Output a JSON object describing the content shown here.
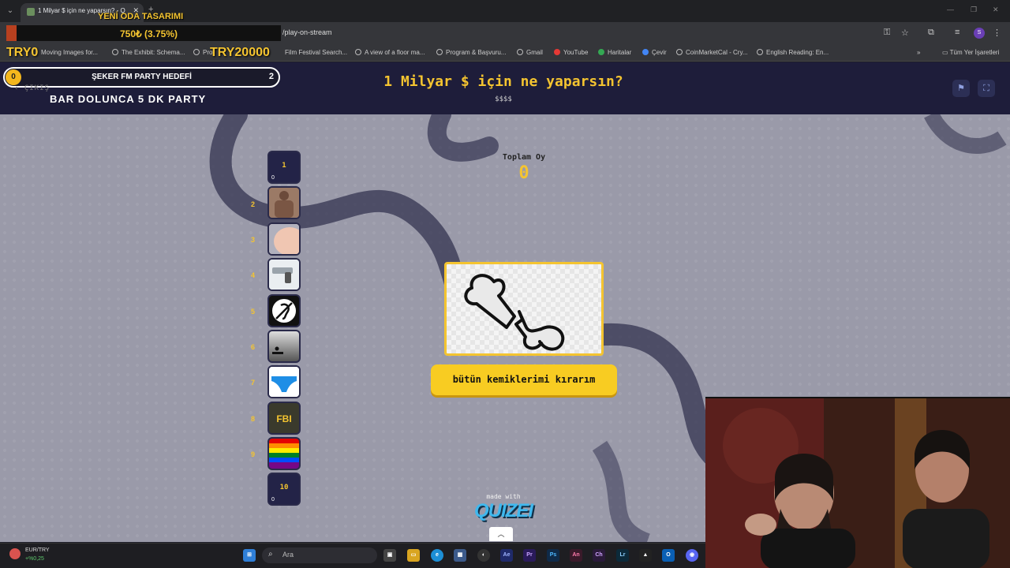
{
  "browser": {
    "tab_title": "1 Milyar $ için ne yaparsın? - Q",
    "url": "/play-on-stream",
    "bookmarks": [
      {
        "label": "Moving Images for..."
      },
      {
        "label": "The Exhibit: Schema..."
      },
      {
        "label": "Pro"
      },
      {
        "label": "Film Festival Search..."
      },
      {
        "label": "A view of a floor ma..."
      },
      {
        "label": "Program & Başvuru..."
      },
      {
        "label": "Gmail"
      },
      {
        "label": "YouTube"
      },
      {
        "label": "Haritalar"
      },
      {
        "label": "Çevir"
      },
      {
        "label": "CoinMarketCal - Cry..."
      },
      {
        "label": "English Reading: En..."
      }
    ],
    "all_bookmarks": "Tüm Yer İşaretleri",
    "profile_initial": "S"
  },
  "overlay": {
    "title": "YENİ ODA TASARIMI",
    "progress_text": "750₺ (3.75%)",
    "progress_fraction": 0.0375,
    "start_label": "TRY0",
    "end_label": "TRY20000"
  },
  "quiz": {
    "goal": {
      "start": "0",
      "label": "ŞEKER FM PARTY HEDEFİ",
      "end": "2"
    },
    "exit_label": "ÇIKIŞ",
    "party_label": "BAR DOLUNCA 5 DK PARTY",
    "title": "1 Milyar $ için ne yaparsın?",
    "subtitle": "$$$$",
    "total_label": "Toplam Oy",
    "total_value": "0",
    "answer": "bütün kemiklerimi kırarım",
    "made_with": "made with",
    "brand": "QUIZEI",
    "ladder": [
      {
        "n": "1",
        "text": "1",
        "count": "0"
      },
      {
        "n": "2"
      },
      {
        "n": "3"
      },
      {
        "n": "4"
      },
      {
        "n": "5"
      },
      {
        "n": "6"
      },
      {
        "n": "7"
      },
      {
        "n": "8",
        "text": "FBI"
      },
      {
        "n": "9"
      },
      {
        "n": "10",
        "text": "10",
        "count": "0"
      }
    ]
  },
  "taskbar": {
    "widget_label": "EUR/TRY",
    "widget_value": "+%0,25",
    "search_placeholder": "Ara"
  },
  "colors": {
    "accent": "#f4c430",
    "header": "#1e1d3a",
    "stage": "#9a9aa9"
  }
}
